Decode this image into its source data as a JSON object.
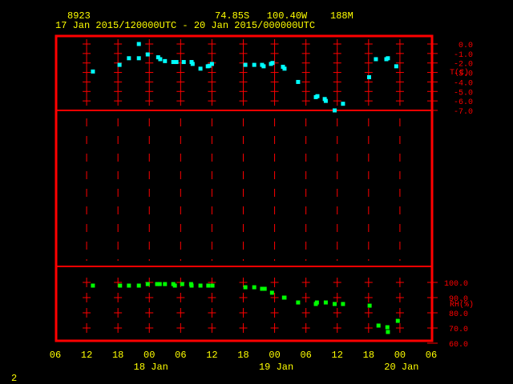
{
  "header": {
    "station": "8923",
    "location": "74.85S   100.40W    188M",
    "time_range": "17 Jan 2015/120000UTC - 20 Jan 2015/000000UTC"
  },
  "footer_label": "2",
  "colors": {
    "frame": "#ff0000",
    "text": "#ffff00",
    "temperature": "#00ffff",
    "rh": "#00ff00"
  },
  "chart_data": [
    {
      "type": "scatter",
      "title": "T(C)",
      "ylabel": "T(C)",
      "xunit": "hours since 17 Jan 06UTC",
      "xlim": [
        0,
        72
      ],
      "ylim": [
        -7,
        0
      ],
      "yticks": [
        "0.0",
        "-1.0",
        "-2.0",
        "-3.0",
        "-4.0",
        "-5.0",
        "-6.0",
        "-7.0"
      ],
      "x": [
        7.2,
        12.3,
        14.1,
        16.0,
        16.0,
        17.7,
        19.7,
        20.1,
        21.0,
        22.6,
        23.2,
        24.6,
        26.1,
        26.3,
        27.8,
        29.2,
        29.5,
        30.0,
        36.4,
        38.1,
        39.6,
        39.9,
        41.3,
        41.6,
        43.6,
        43.9,
        46.5,
        49.9,
        50.2,
        51.6,
        51.8,
        53.5,
        55.1,
        60.1,
        61.4,
        63.4,
        63.7,
        65.3
      ],
      "y": [
        -2.9,
        -2.2,
        -1.5,
        0.0,
        -1.5,
        -1.1,
        -1.4,
        -1.6,
        -1.8,
        -1.9,
        -1.9,
        -1.9,
        -1.9,
        -2.1,
        -2.6,
        -2.35,
        -2.3,
        -2.1,
        -2.2,
        -2.2,
        -2.2,
        -2.35,
        -2.1,
        -2.0,
        -2.4,
        -2.6,
        -4.0,
        -5.6,
        -5.5,
        -5.8,
        -6.0,
        -7.0,
        -6.3,
        -3.5,
        -1.6,
        -1.6,
        -1.5,
        -2.35
      ]
    },
    {
      "type": "scatter",
      "title": "RH(%)",
      "ylabel": "RH(%)",
      "xunit": "hours since 17 Jan 06UTC",
      "xlim": [
        0,
        72
      ],
      "ylim": [
        60,
        100
      ],
      "yticks": [
        "100.0",
        "90.0",
        "80.0",
        "70.0",
        "60.0"
      ],
      "x": [
        7.2,
        12.4,
        14.1,
        16.0,
        17.7,
        19.5,
        20.0,
        21.0,
        22.6,
        22.9,
        24.3,
        26.0,
        26.1,
        27.8,
        29.3,
        30.1,
        36.4,
        38.1,
        39.6,
        40.1,
        41.5,
        43.8,
        43.9,
        46.5,
        49.9,
        50.1,
        51.8,
        53.5,
        55.1,
        60.2,
        61.9,
        63.6,
        63.7,
        65.6
      ],
      "y": [
        97.9,
        97.9,
        97.9,
        97.9,
        98.9,
        98.9,
        98.9,
        98.9,
        98.9,
        97.9,
        98.9,
        98.9,
        97.9,
        97.9,
        97.9,
        97.9,
        96.8,
        96.8,
        95.8,
        95.8,
        93.2,
        90.0,
        90.0,
        86.8,
        85.8,
        86.8,
        86.8,
        85.8,
        85.8,
        84.7,
        71.6,
        70.5,
        67.4,
        74.7
      ]
    }
  ],
  "xaxis": {
    "ticks": [
      "06",
      "12",
      "18",
      "00",
      "06",
      "12",
      "18",
      "00",
      "06",
      "12",
      "18",
      "00",
      "06"
    ],
    "dates": [
      "18 Jan",
      "19 Jan",
      "20 Jan"
    ]
  }
}
